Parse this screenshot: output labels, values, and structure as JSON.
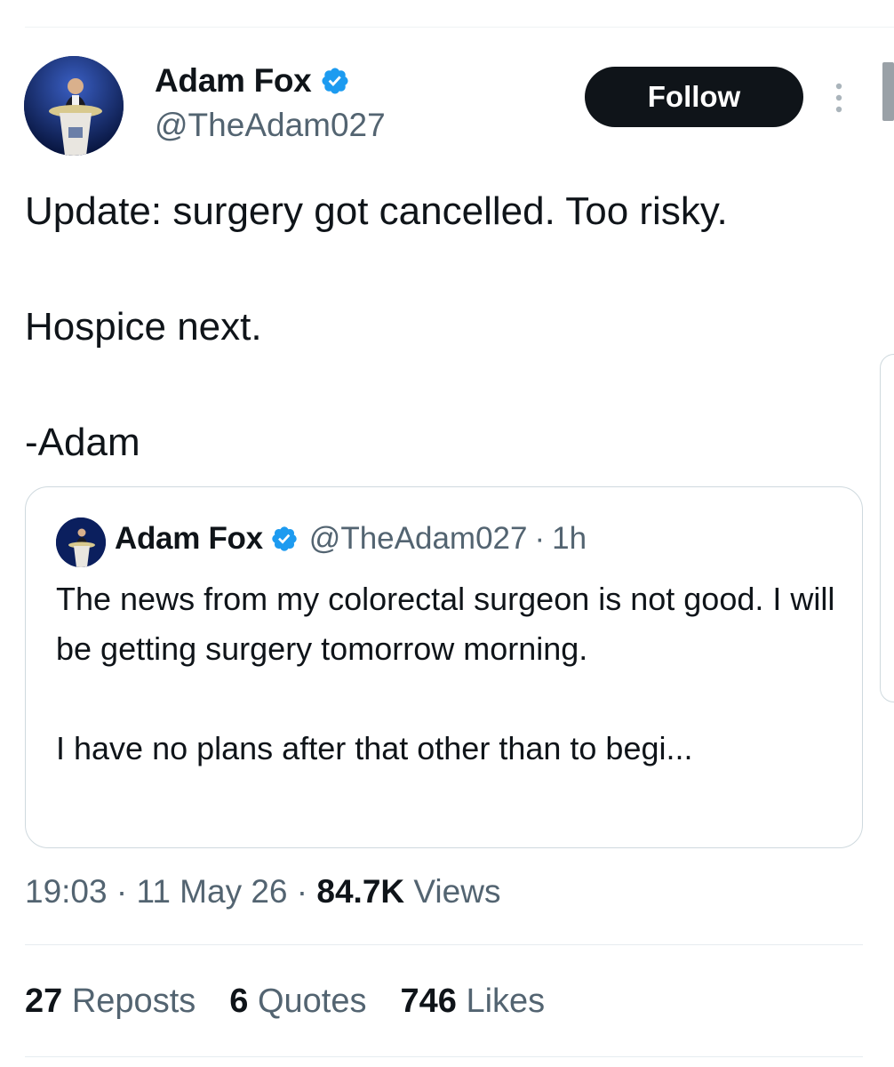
{
  "author": {
    "name": "Adam Fox",
    "handle": "@TheAdam027",
    "verified_icon": "verified-badge-icon"
  },
  "follow_button": {
    "label": "Follow"
  },
  "tweet": {
    "paragraphs": [
      "Update: surgery got cancelled. Too risky.",
      "Hospice next.",
      "-Adam"
    ]
  },
  "quote": {
    "name": "Adam Fox",
    "handle": "@TheAdam027",
    "separator": "·",
    "time": "1h",
    "text_p1": "The news from my colorectal surgeon is not good. I will be getting surgery tomorrow morning.",
    "text_p2": "I have no plans after that other than to begi..."
  },
  "meta": {
    "time": "19:03",
    "sep1": "·",
    "date": "11 May 26",
    "sep2": "·",
    "views_count": "84.7K",
    "views_label": "Views"
  },
  "stats": {
    "reposts_count": "27",
    "reposts_label": "Reposts",
    "quotes_count": "6",
    "quotes_label": "Quotes",
    "likes_count": "746",
    "likes_label": "Likes"
  },
  "colors": {
    "text": "#0f1419",
    "secondary": "#536471",
    "verified": "#1d9bf0",
    "button_bg": "#0f1419",
    "border": "#cfd9de"
  }
}
